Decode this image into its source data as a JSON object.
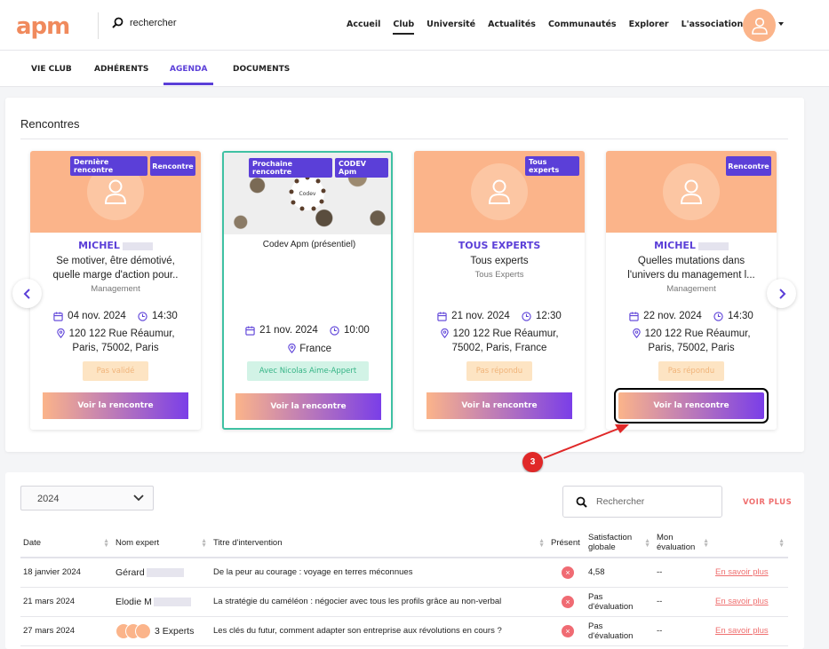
{
  "header": {
    "logo": "apm",
    "search_placeholder": "rechercher",
    "nav": [
      "Accueil",
      "Club",
      "Université",
      "Actualités",
      "Communautés",
      "Explorer",
      "L'association"
    ],
    "nav_active": "Club"
  },
  "subtabs": {
    "items": [
      "VIE CLUB",
      "ADHÉRENTS",
      "AGENDA",
      "DOCUMENTS"
    ],
    "active": "AGENDA"
  },
  "rencontres": {
    "title": "Rencontres",
    "cards": [
      {
        "badges": [
          "Dernière rencontre",
          "Rencontre"
        ],
        "author": "MICHEL",
        "title_line1": "Se motiver, être démotivé,",
        "title_line2": "quelle marge d'action pour..",
        "category": "Management",
        "date": "04 nov. 2024",
        "time": "14:30",
        "address_line1": "120 122 Rue Réaumur,",
        "address_line2": "Paris, 75002, Paris",
        "status": "Pas validé",
        "cta": "Voir la rencontre"
      },
      {
        "badges": [
          "Prochaine rencontre",
          "CODEV Apm"
        ],
        "image_caption": "Codev",
        "title_line1": "Codev Apm (présentiel)",
        "date": "21 nov. 2024",
        "time": "10:00",
        "address_line1": "France",
        "status": "Avec Nicolas Aime-Appert",
        "cta": "Voir la rencontre"
      },
      {
        "badges": [
          "Tous experts"
        ],
        "author": "TOUS EXPERTS",
        "title_line1": "Tous experts",
        "category": "Tous Experts",
        "date": "21 nov. 2024",
        "time": "12:30",
        "address_line1": "120 122 Rue Réaumur,",
        "address_line2": "75002, Paris, France",
        "status": "Pas répondu",
        "cta": "Voir la rencontre"
      },
      {
        "badges": [
          "Rencontre"
        ],
        "author": "MICHEL",
        "title_line1": "Quelles mutations dans",
        "title_line2": "l'univers du management l...",
        "category": "Management",
        "date": "22 nov. 2024",
        "time": "14:30",
        "address_line1": "120 122 Rue Réaumur,",
        "address_line2": "Paris, 75002, Paris",
        "status": "Pas répondu",
        "cta": "Voir la rencontre"
      }
    ]
  },
  "annotation": {
    "marker": "3"
  },
  "history": {
    "year": "2024",
    "search_placeholder": "Rechercher",
    "voir_plus": "VOIR PLUS",
    "columns": {
      "date": "Date",
      "expert": "Nom expert",
      "title": "Titre d'intervention",
      "present": "Présent",
      "satisfaction_1": "Satisfaction",
      "satisfaction_2": "globale",
      "evaluation_1": "Mon",
      "evaluation_2": "évaluation"
    },
    "rows": [
      {
        "date": "18 janvier 2024",
        "expert": "Gérard",
        "title": "De la peur au courage : voyage en terres méconnues",
        "present": "×",
        "satisfaction_1": "4,58",
        "satisfaction_2": "",
        "evaluation": "--",
        "link": "En savoir plus"
      },
      {
        "date": "21 mars 2024",
        "expert": "Elodie M",
        "title": "La stratégie du caméléon : négocier avec tous les profils grâce au non-verbal",
        "present": "×",
        "satisfaction_1": "Pas",
        "satisfaction_2": "d'évaluation",
        "evaluation": "--",
        "link": "En savoir plus"
      },
      {
        "date": "27 mars 2024",
        "expert": "3 Experts",
        "title": "Les clés du futur, comment adapter son entreprise aux révolutions en cours ?",
        "present": "×",
        "satisfaction_1": "Pas",
        "satisfaction_2": "d'évaluation",
        "evaluation": "--",
        "link": "En savoir plus"
      }
    ]
  },
  "colors": {
    "accent": "#5b3fd8",
    "orange": "#fbb48a",
    "danger": "#f06b73",
    "teal": "#3fc1a3"
  }
}
